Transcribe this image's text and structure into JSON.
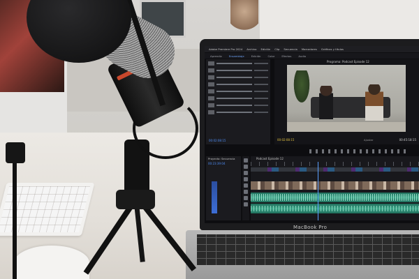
{
  "laptop": {
    "brand_label": "MacBook Pro"
  },
  "premiere": {
    "app_title": "Adobe Premiere Pro 2024",
    "menu": [
      "Archivo",
      "Edición",
      "Clip",
      "Secuencia",
      "Marcadores",
      "Gráficos y títulos"
    ],
    "workspace_tabs": [
      "Aprendiz",
      "Ensamblaje",
      "Edición",
      "Color",
      "Efectos",
      "Audio"
    ],
    "active_tab": "Ensamblaje",
    "program_title": "Programa: Podcast Episode 12",
    "program_timecode_left": "00:02:08:15",
    "program_timecode_right": "00:45:18:15",
    "fit_label": "Ajustar",
    "project_timecode": "00:02:08:15",
    "media_panel_title": "Proyecto: Secuencia",
    "media_timecode": "00:23:39:04",
    "timeline_title": "Podcast Episode 12"
  },
  "icons": {
    "microphone": "microphone-icon",
    "tripod": "tripod-icon"
  },
  "colors": {
    "accent_blue": "#4d8cf5",
    "audio_green": "#3ea689",
    "mic_ring": "#c8482c"
  }
}
